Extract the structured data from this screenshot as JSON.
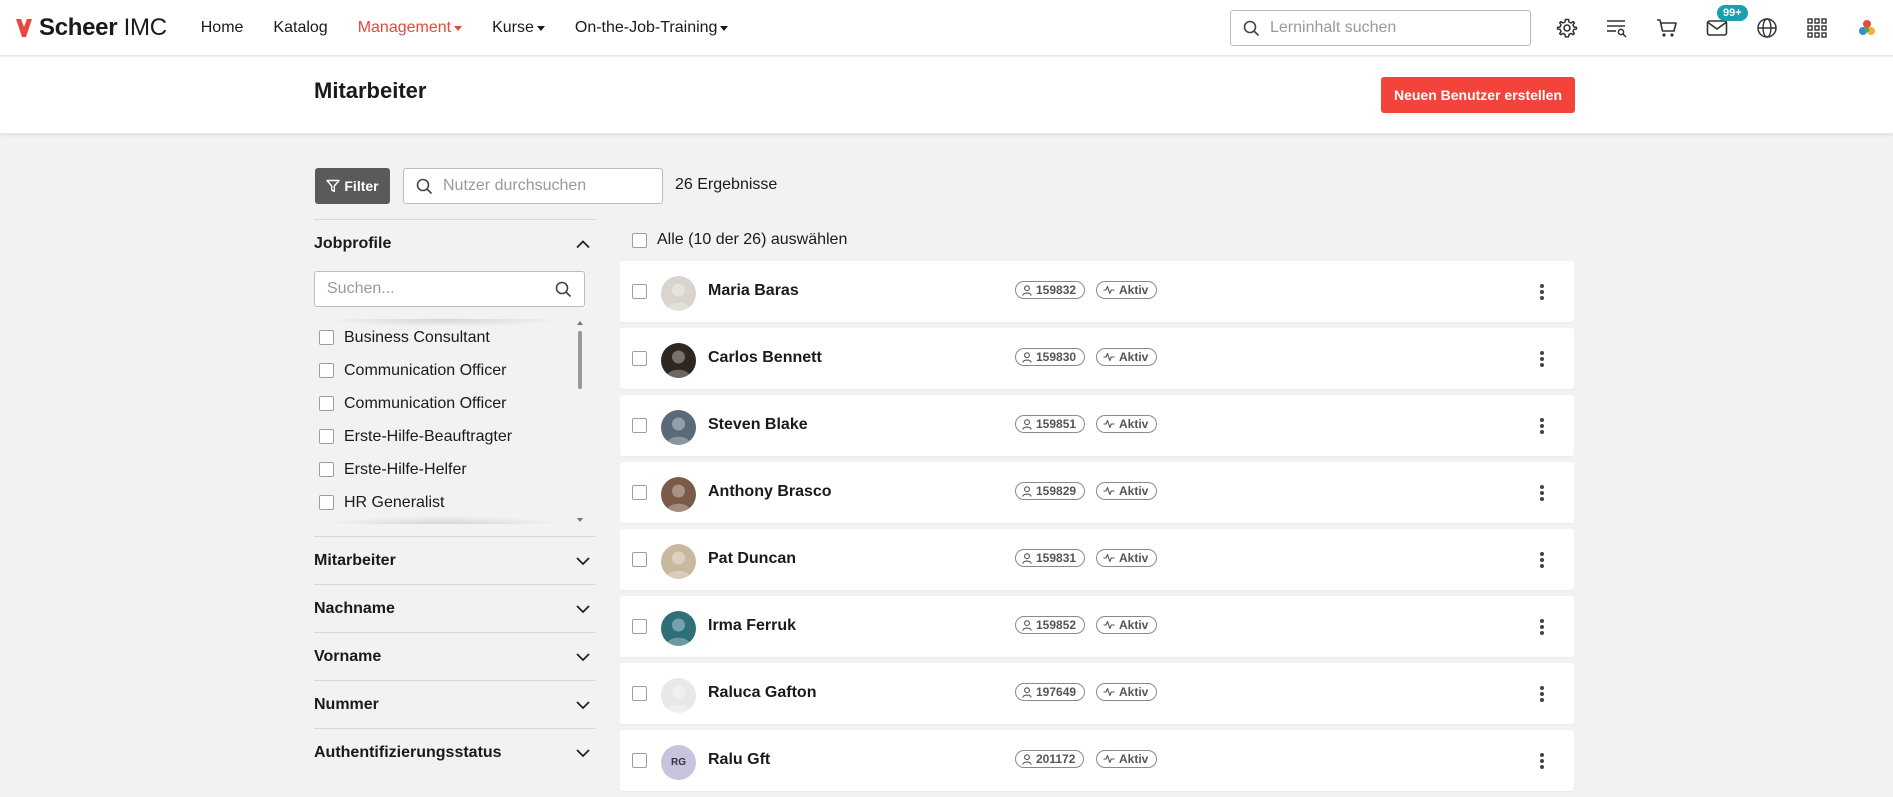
{
  "brand": {
    "name_bold": "Scheer",
    "name_thin": "IMC",
    "accent": "#e8473e"
  },
  "nav": {
    "items": [
      {
        "label": "Home",
        "active": false,
        "dropdown": false
      },
      {
        "label": "Katalog",
        "active": false,
        "dropdown": false
      },
      {
        "label": "Management",
        "active": true,
        "dropdown": true
      },
      {
        "label": "Kurse",
        "active": false,
        "dropdown": true
      },
      {
        "label": "On-the-Job-Training",
        "active": false,
        "dropdown": true
      }
    ],
    "search_placeholder": "Lerninhalt suchen",
    "icons": [
      "gear-icon",
      "playlist-search-icon",
      "cart-icon",
      "mail-icon",
      "globe-icon",
      "app-grid-icon",
      "profile-logo-icon"
    ],
    "mail_badge": "99+"
  },
  "header": {
    "title": "Mitarbeiter",
    "new_user_label": "Neuen Benutzer erstellen",
    "button_color": "#f4433a"
  },
  "toolbar": {
    "filter_label": "Filter",
    "search_placeholder": "Nutzer durchsuchen",
    "result_count": "26 Ergebnisse"
  },
  "filters": {
    "jobprofile": {
      "title": "Jobprofile",
      "search_placeholder": "Suchen...",
      "options": [
        "Business Consultant",
        "Communication Officer",
        "Communication Officer",
        "Erste-Hilfe-Beauftragter",
        "Erste-Hilfe-Helfer",
        "HR Generalist"
      ]
    },
    "sections": [
      "Mitarbeiter",
      "Nachname",
      "Vorname",
      "Nummer",
      "Authentifizierungsstatus"
    ]
  },
  "list": {
    "select_all_label": "Alle (10 der 26) auswählen",
    "users": [
      {
        "name": "Maria Baras",
        "id": "159832",
        "status": "Aktiv",
        "avatar_color": "#d9d4cc",
        "initials": ""
      },
      {
        "name": "Carlos Bennett",
        "id": "159830",
        "status": "Aktiv",
        "avatar_color": "#2e2620",
        "initials": ""
      },
      {
        "name": "Steven Blake",
        "id": "159851",
        "status": "Aktiv",
        "avatar_color": "#5a6a78",
        "initials": ""
      },
      {
        "name": "Anthony Brasco",
        "id": "159829",
        "status": "Aktiv",
        "avatar_color": "#7a5a48",
        "initials": ""
      },
      {
        "name": "Pat Duncan",
        "id": "159831",
        "status": "Aktiv",
        "avatar_color": "#c8b8a0",
        "initials": ""
      },
      {
        "name": "Irma Ferruk",
        "id": "159852",
        "status": "Aktiv",
        "avatar_color": "#2f6f7a",
        "initials": ""
      },
      {
        "name": "Raluca Gafton",
        "id": "197649",
        "status": "Aktiv",
        "avatar_color": "#e8e8e8",
        "initials": ""
      },
      {
        "name": "Ralu Gft",
        "id": "201172",
        "status": "Aktiv",
        "avatar_color": "#c9c3e0",
        "initials": "RG"
      }
    ]
  }
}
